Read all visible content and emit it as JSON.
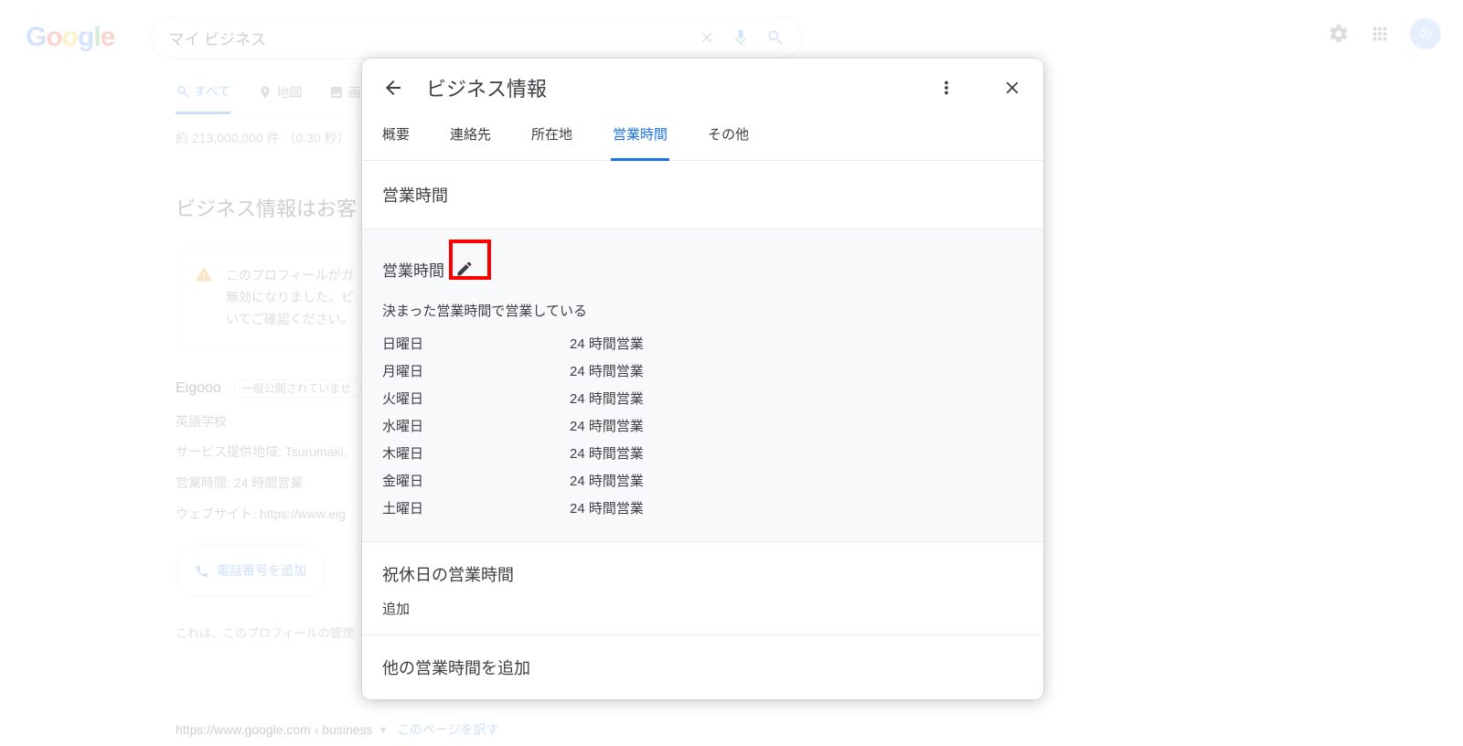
{
  "search": {
    "query": "マイ ビジネス"
  },
  "avatar_letter": "の",
  "tabs": {
    "all": "すべて",
    "maps": "地図",
    "images_prefix": "画"
  },
  "stats": "約 213,000,000 件 （0.30 秒）",
  "heading": "ビジネス情報はお客",
  "warning": {
    "line1": "このプロフィールがガ",
    "line2": "無効になりました。ビ",
    "line3": "いてご確認ください。"
  },
  "kp": {
    "name": "Eigooo",
    "badge": "一般公開されていませ",
    "category": "英語学校",
    "service_label": "サービス提供地域:",
    "service_value": "Tsurumaki,",
    "hours_label": "営業時間:",
    "hours_value": "24 時間営業",
    "website_label": "ウェブサイト:",
    "website_value": "https://www.eig",
    "phone_button": "電話番号を追加",
    "note": "これは、このプロフィールの管理"
  },
  "result": {
    "url": "https://www.google.com › business",
    "translate": "このページを訳す"
  },
  "modal": {
    "title": "ビジネス情報",
    "tabs": {
      "overview": "概要",
      "contact": "連絡先",
      "location": "所在地",
      "hours": "営業時間",
      "more": "その他"
    },
    "section_title": "営業時間",
    "hours_title": "営業時間",
    "hours_subtitle": "決まった営業時間で営業している",
    "days": [
      {
        "day": "日曜日",
        "hours": "24 時間営業"
      },
      {
        "day": "月曜日",
        "hours": "24 時間営業"
      },
      {
        "day": "火曜日",
        "hours": "24 時間営業"
      },
      {
        "day": "水曜日",
        "hours": "24 時間営業"
      },
      {
        "day": "木曜日",
        "hours": "24 時間営業"
      },
      {
        "day": "金曜日",
        "hours": "24 時間営業"
      },
      {
        "day": "土曜日",
        "hours": "24 時間営業"
      }
    ],
    "holiday_title": "祝休日の営業時間",
    "holiday_add": "追加",
    "more_hours": "他の営業時間を追加"
  }
}
